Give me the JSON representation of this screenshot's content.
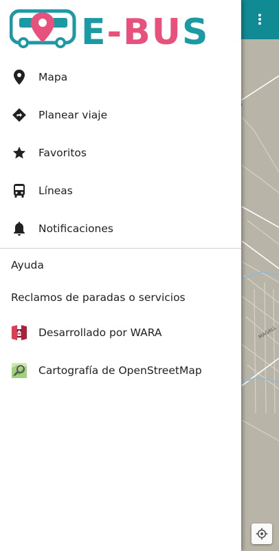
{
  "app": {
    "logo_text": "E-BUS",
    "brand_teal": "#1b9aa4",
    "brand_pink": "#e9517d"
  },
  "menu": {
    "primary": [
      {
        "label": "Mapa",
        "icon": "location-pin-icon"
      },
      {
        "label": "Planear viaje",
        "icon": "directions-icon"
      },
      {
        "label": "Favoritos",
        "icon": "star-icon"
      },
      {
        "label": "Líneas",
        "icon": "bus-icon"
      },
      {
        "label": "Notificaciones",
        "icon": "bell-icon"
      }
    ],
    "secondary": [
      {
        "label": "Ayuda"
      },
      {
        "label": "Reclamos de paradas o servicios"
      }
    ],
    "credits": [
      {
        "label": "Desarrollado por WARA",
        "icon": "wara-logo-icon"
      },
      {
        "label": "Cartografía de OpenStreetMap",
        "icon": "openstreetmap-logo-icon"
      }
    ]
  },
  "map": {
    "appbar_color": "#108a93",
    "street_label_1": "MAGALL",
    "street_label_2": "A"
  }
}
